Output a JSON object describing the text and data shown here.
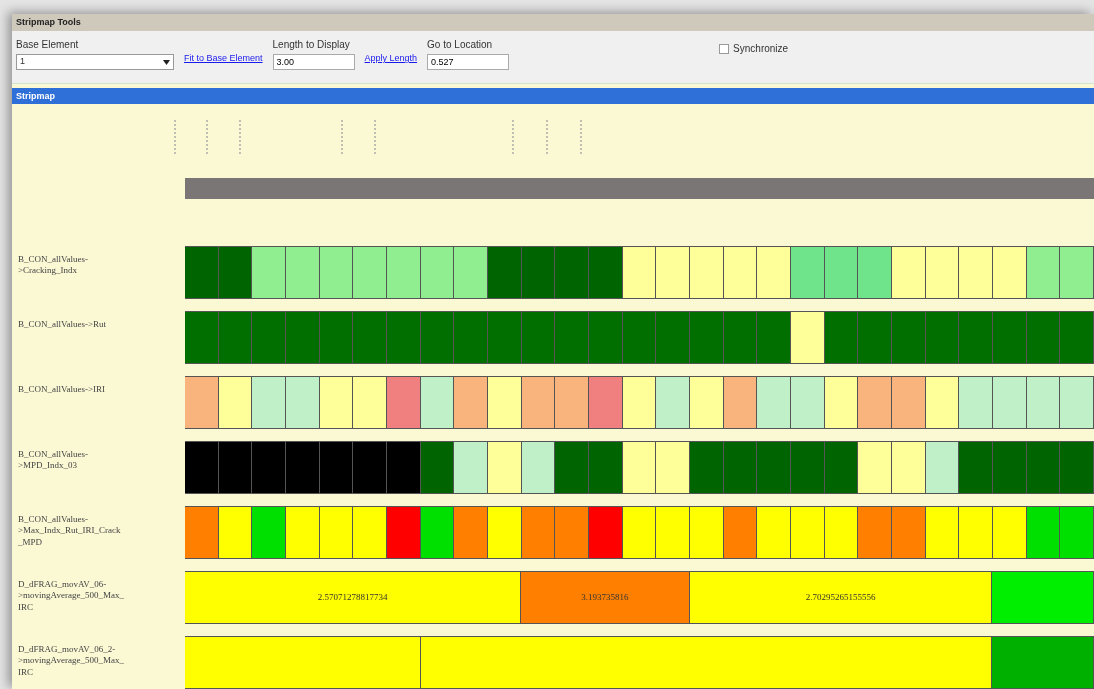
{
  "window": {
    "title": "Stripmap Tools"
  },
  "toolbar": {
    "base_element": {
      "label": "Base Element",
      "value": "1"
    },
    "fit_link": "Fit to Base Element",
    "length": {
      "label": "Length to Display",
      "value": "3.00"
    },
    "apply_link": "Apply Length",
    "location": {
      "label": "Go to Location",
      "value": "0.527"
    },
    "synchronize": {
      "label": "Synchronize",
      "checked": false
    }
  },
  "panel": {
    "title": "Stripmap"
  },
  "strips": [
    {
      "label": "B_CON_allValues->Cracking_Indx",
      "kind": "cells",
      "cells": [
        {
          "color": "#006400"
        },
        {
          "color": "#006400"
        },
        {
          "color": "#90ee90"
        },
        {
          "color": "#90ee90"
        },
        {
          "color": "#90ee90"
        },
        {
          "color": "#90ee90"
        },
        {
          "color": "#90ee90"
        },
        {
          "color": "#90ee90"
        },
        {
          "color": "#90ee90"
        },
        {
          "color": "#006400"
        },
        {
          "color": "#006400"
        },
        {
          "color": "#006400"
        },
        {
          "color": "#006400"
        },
        {
          "color": "#ffff99"
        },
        {
          "color": "#ffff99"
        },
        {
          "color": "#ffff99"
        },
        {
          "color": "#ffff99"
        },
        {
          "color": "#ffff99"
        },
        {
          "color": "#70e48a"
        },
        {
          "color": "#70e48a"
        },
        {
          "color": "#70e48a"
        },
        {
          "color": "#ffff99"
        },
        {
          "color": "#ffff99"
        },
        {
          "color": "#ffff99"
        },
        {
          "color": "#ffff99"
        },
        {
          "color": "#90ee90"
        },
        {
          "color": "#90ee90"
        }
      ]
    },
    {
      "label": "B_CON_allValues->Rut",
      "kind": "cells",
      "cells": [
        {
          "color": "#006f00"
        },
        {
          "color": "#006f00"
        },
        {
          "color": "#006f00"
        },
        {
          "color": "#006f00"
        },
        {
          "color": "#006f00"
        },
        {
          "color": "#006f00"
        },
        {
          "color": "#006f00"
        },
        {
          "color": "#006f00"
        },
        {
          "color": "#006f00"
        },
        {
          "color": "#006f00"
        },
        {
          "color": "#006f00"
        },
        {
          "color": "#006f00"
        },
        {
          "color": "#006f00"
        },
        {
          "color": "#006f00"
        },
        {
          "color": "#006f00"
        },
        {
          "color": "#006f00"
        },
        {
          "color": "#006f00"
        },
        {
          "color": "#006f00"
        },
        {
          "color": "#ffff99"
        },
        {
          "color": "#006f00"
        },
        {
          "color": "#006f00"
        },
        {
          "color": "#006f00"
        },
        {
          "color": "#006f00"
        },
        {
          "color": "#006f00"
        },
        {
          "color": "#006f00"
        },
        {
          "color": "#006f00"
        },
        {
          "color": "#006f00"
        }
      ]
    },
    {
      "label": "B_CON_allValues->IRI",
      "kind": "cells",
      "cells": [
        {
          "color": "#f8b47c"
        },
        {
          "color": "#ffff99"
        },
        {
          "color": "#c0f0c8"
        },
        {
          "color": "#c0f0c8"
        },
        {
          "color": "#ffff99"
        },
        {
          "color": "#ffff99"
        },
        {
          "color": "#f08080"
        },
        {
          "color": "#c0f0c8"
        },
        {
          "color": "#f8b47c"
        },
        {
          "color": "#ffff99"
        },
        {
          "color": "#f8b47c"
        },
        {
          "color": "#f8b47c"
        },
        {
          "color": "#f08080"
        },
        {
          "color": "#ffff99"
        },
        {
          "color": "#c0f0c8"
        },
        {
          "color": "#ffff99"
        },
        {
          "color": "#f8b47c"
        },
        {
          "color": "#c0f0c8"
        },
        {
          "color": "#c0f0c8"
        },
        {
          "color": "#ffff99"
        },
        {
          "color": "#f8b47c"
        },
        {
          "color": "#f8b47c"
        },
        {
          "color": "#ffff99"
        },
        {
          "color": "#c0f0c8"
        },
        {
          "color": "#c0f0c8"
        },
        {
          "color": "#c0f0c8"
        },
        {
          "color": "#c0f0c8"
        }
      ]
    },
    {
      "label": "B_CON_allValues->MPD_Indx_03",
      "kind": "cells",
      "cells": [
        {
          "color": "#000000"
        },
        {
          "color": "#000000"
        },
        {
          "color": "#000000"
        },
        {
          "color": "#000000"
        },
        {
          "color": "#000000"
        },
        {
          "color": "#000000"
        },
        {
          "color": "#000000"
        },
        {
          "color": "#006400"
        },
        {
          "color": "#c0f0c8"
        },
        {
          "color": "#ffff99"
        },
        {
          "color": "#c0f0c8"
        },
        {
          "color": "#006400"
        },
        {
          "color": "#006400"
        },
        {
          "color": "#ffff99"
        },
        {
          "color": "#ffff99"
        },
        {
          "color": "#006400"
        },
        {
          "color": "#006400"
        },
        {
          "color": "#006400"
        },
        {
          "color": "#006400"
        },
        {
          "color": "#006400"
        },
        {
          "color": "#ffff99"
        },
        {
          "color": "#ffff99"
        },
        {
          "color": "#c0f0c8"
        },
        {
          "color": "#006400"
        },
        {
          "color": "#006400"
        },
        {
          "color": "#006400"
        },
        {
          "color": "#006400"
        }
      ]
    },
    {
      "label": "B_CON_allValues->Max_Indx_Rut_IRI_Crack_MPD",
      "kind": "cells",
      "cells": [
        {
          "color": "#ff8000"
        },
        {
          "color": "#ffff00"
        },
        {
          "color": "#00e000"
        },
        {
          "color": "#ffff00"
        },
        {
          "color": "#ffff00"
        },
        {
          "color": "#ffff00"
        },
        {
          "color": "#ff0000"
        },
        {
          "color": "#00e000"
        },
        {
          "color": "#ff8000"
        },
        {
          "color": "#ffff00"
        },
        {
          "color": "#ff8000"
        },
        {
          "color": "#ff8000"
        },
        {
          "color": "#ff0000"
        },
        {
          "color": "#ffff00"
        },
        {
          "color": "#ffff00"
        },
        {
          "color": "#ffff00"
        },
        {
          "color": "#ff8000"
        },
        {
          "color": "#ffff00"
        },
        {
          "color": "#ffff00"
        },
        {
          "color": "#ffff00"
        },
        {
          "color": "#ff8000"
        },
        {
          "color": "#ff8000"
        },
        {
          "color": "#ffff00"
        },
        {
          "color": "#ffff00"
        },
        {
          "color": "#ffff00"
        },
        {
          "color": "#00e000"
        },
        {
          "color": "#00e000"
        }
      ]
    },
    {
      "label": "D_dFRAG_movAV_06->movingAverage_500_Max_IRC",
      "kind": "segments",
      "segments": [
        {
          "value": "2.57071278817734",
          "cells": [
            {
              "color": "#ffff00"
            },
            {
              "color": "#ffff00"
            },
            {
              "color": "#ffff00"
            },
            {
              "color": "#ffff00"
            },
            {
              "color": "#ffff00"
            },
            {
              "color": "#ffff00"
            },
            {
              "color": "#ffff00"
            },
            {
              "color": "#ffff00"
            },
            {
              "color": "#ffff00"
            },
            {
              "color": "#ffff00"
            }
          ]
        },
        {
          "value": "3.193735816",
          "cells": [
            {
              "color": "#ff8000"
            },
            {
              "color": "#ff8000"
            },
            {
              "color": "#ff8000"
            },
            {
              "color": "#ff8000"
            },
            {
              "color": "#ff8000"
            }
          ]
        },
        {
          "value": "2.70295265155556",
          "cells": [
            {
              "color": "#ffff00"
            },
            {
              "color": "#ffff00"
            },
            {
              "color": "#ffff00"
            },
            {
              "color": "#ffff00"
            },
            {
              "color": "#ffff00"
            },
            {
              "color": "#ffff00"
            },
            {
              "color": "#ffff00"
            },
            {
              "color": "#ffff00"
            },
            {
              "color": "#ffff00"
            }
          ]
        },
        {
          "cells": [
            {
              "color": "#00ee00"
            },
            {
              "color": "#00ee00"
            },
            {
              "color": "#00ee00"
            }
          ]
        }
      ]
    },
    {
      "label": "D_dFRAG_movAV_06_2->movingAverage_500_Max_IRC",
      "kind": "segments",
      "segments": [
        {
          "cells": [
            {
              "color": "#ffff00"
            },
            {
              "color": "#ffff00"
            },
            {
              "color": "#ffff00"
            },
            {
              "color": "#ffff00"
            },
            {
              "color": "#ffff00"
            },
            {
              "color": "#ffff00"
            },
            {
              "color": "#ffff00"
            }
          ]
        },
        {
          "cells": [
            {
              "color": "#ffff00"
            },
            {
              "color": "#ffff00"
            },
            {
              "color": "#ffff00"
            },
            {
              "color": "#ffff00"
            },
            {
              "color": "#ffff00"
            },
            {
              "color": "#ffff00"
            },
            {
              "color": "#ffff00"
            },
            {
              "color": "#ffff00"
            },
            {
              "color": "#ffff00"
            },
            {
              "color": "#ffff00"
            },
            {
              "color": "#ffff00"
            },
            {
              "color": "#ffff00"
            },
            {
              "color": "#ffff00"
            },
            {
              "color": "#ffff00"
            },
            {
              "color": "#ffff00"
            },
            {
              "color": "#ffff00"
            },
            {
              "color": "#ffff00"
            }
          ]
        },
        {
          "cells": [
            {
              "color": "#00b000"
            },
            {
              "color": "#00b000"
            },
            {
              "color": "#00b000"
            }
          ]
        }
      ]
    }
  ]
}
